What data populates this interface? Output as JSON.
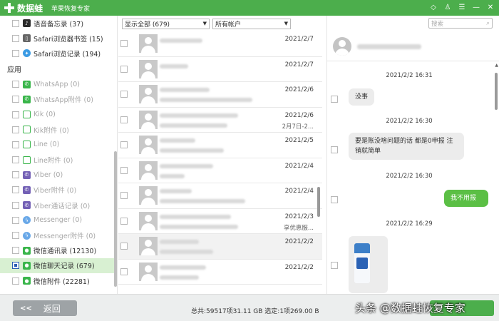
{
  "titlebar": {
    "app_name": "数据蛙",
    "subtitle": "苹果恢复专家"
  },
  "sidebar": {
    "top_items": [
      {
        "label": "语音备忘录 (37)",
        "icon": "voice-memo-icon"
      },
      {
        "label": "Safari浏览器书签 (15)",
        "icon": "book-icon"
      },
      {
        "label": "Safari浏览记录 (194)",
        "icon": "compass-icon"
      }
    ],
    "apps_heading": "应用",
    "app_items": [
      {
        "label": "WhatsApp (0)",
        "icon": "whatsapp-icon"
      },
      {
        "label": "WhatsApp附件 (0)",
        "icon": "whatsapp-icon"
      },
      {
        "label": "Kik (0)",
        "icon": "kik-icon"
      },
      {
        "label": "Kik附件 (0)",
        "icon": "kik-icon"
      },
      {
        "label": "Line (0)",
        "icon": "line-icon"
      },
      {
        "label": "Line附件 (0)",
        "icon": "line-icon"
      },
      {
        "label": "Viber (0)",
        "icon": "viber-icon"
      },
      {
        "label": "Viber附件 (0)",
        "icon": "viber-icon"
      },
      {
        "label": "Viber通话记录 (0)",
        "icon": "viber-icon"
      },
      {
        "label": "Messenger (0)",
        "icon": "messenger-icon"
      },
      {
        "label": "Messenger附件 (0)",
        "icon": "messenger-icon"
      },
      {
        "label": "微信通讯录 (12130)",
        "icon": "wechat-icon"
      },
      {
        "label": "微信聊天记录 (679)",
        "icon": "wechat-icon"
      },
      {
        "label": "微信附件 (22281)",
        "icon": "wechat-icon"
      }
    ]
  },
  "filters": {
    "show_all": "显示全部 (679)",
    "all_accounts": "所有帐户"
  },
  "search": {
    "placeholder": "搜索"
  },
  "conversations": [
    {
      "date": "2021/2/7",
      "preview": ""
    },
    {
      "date": "2021/2/7",
      "preview": ""
    },
    {
      "date": "2021/2/6",
      "preview": ""
    },
    {
      "date": "2021/2/6",
      "preview": "2月7日-2..."
    },
    {
      "date": "2021/2/5",
      "preview": ""
    },
    {
      "date": "2021/2/4",
      "preview": ""
    },
    {
      "date": "2021/2/4",
      "preview": ""
    },
    {
      "date": "2021/2/3",
      "preview": "享优惠服..."
    },
    {
      "date": "2021/2/2",
      "preview": ""
    },
    {
      "date": "2021/2/2",
      "preview": ""
    }
  ],
  "messages": {
    "ts1": "2021/2/2 16:31",
    "msg1": "没事",
    "ts2": "2021/2/2 16:30",
    "msg2": "要是账没啥问题的话 都是0申报 注销就简单",
    "ts3": "2021/2/2 16:30",
    "msg3": "我不用报",
    "ts4": "2021/2/2 16:29"
  },
  "footer": {
    "back_label": "返回",
    "status": "总共:59517项31.11 GB 选定:1项269.00 B",
    "watermark": "头条 @数据蛙恢复专家"
  },
  "colors": {
    "brand_green": "#4cae4c",
    "my_bubble": "#5bbf45",
    "selected_row": "#d8f0d2",
    "checkbox_blue": "#2b5fb4"
  }
}
